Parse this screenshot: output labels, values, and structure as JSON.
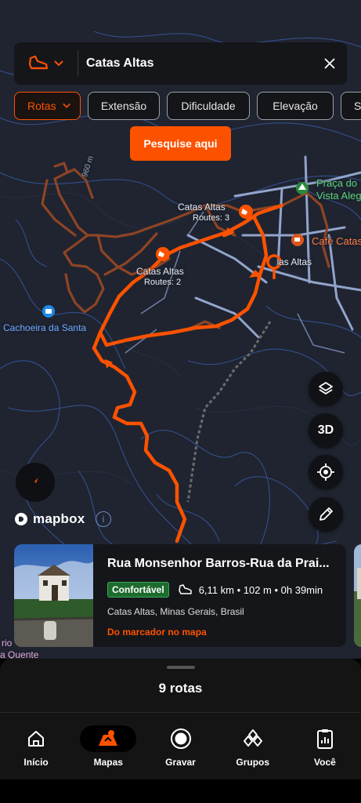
{
  "colors": {
    "accent": "#fc5200",
    "badge_green": "#1d6b2f",
    "route": "#fc5200",
    "trail": "#9a4a2a"
  },
  "search": {
    "activity_icon": "shoe-icon",
    "query": "Catas Altas"
  },
  "filters": [
    {
      "label": "Rotas",
      "active": true
    },
    {
      "label": "Extensão"
    },
    {
      "label": "Dificuldade"
    },
    {
      "label": "Elevação"
    },
    {
      "label": "Su"
    }
  ],
  "search_here_label": "Pesquise aqui",
  "map": {
    "labels": {
      "town1": "Catas Altas",
      "town1_routes": "Routes: 3",
      "town2": "Catas Altas",
      "town2_routes": "Routes: 2",
      "town3": "as Altas",
      "waterfall": "Cachoeira da Santa",
      "praca_line1": "Praça do",
      "praca_line2": "Vista Aleg",
      "cafe": "Café Catas",
      "elevation": "960 m",
      "edge1": "rio",
      "edge2": "a Quente"
    },
    "controls": {
      "three_d": "3D"
    },
    "attribution": "mapbox"
  },
  "route_card": {
    "title": "Rua Monsenhor Barros-Rua da Prai...",
    "difficulty": "Confortável",
    "stats": "6,11 km • 102 m • 0h 39min",
    "place": "Catas Altas, Minas Gerais, Brasil",
    "link": "Do marcador no mapa"
  },
  "sheet": {
    "count_label": "9 rotas"
  },
  "nav": [
    {
      "label": "Início",
      "icon": "home-icon"
    },
    {
      "label": "Mapas",
      "icon": "map-icon",
      "active": true
    },
    {
      "label": "Gravar",
      "icon": "record-icon"
    },
    {
      "label": "Grupos",
      "icon": "groups-icon"
    },
    {
      "label": "Você",
      "icon": "profile-icon"
    }
  ]
}
